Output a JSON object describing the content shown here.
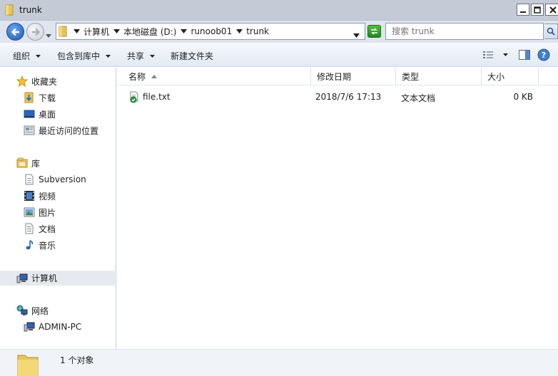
{
  "window": {
    "title": "trunk",
    "buttons": {
      "minimize": "minimize-icon",
      "maximize": "maximize-icon",
      "close": "close-icon"
    }
  },
  "address": {
    "breadcrumbs": [
      "计算机",
      "本地磁盘 (D:)",
      "runoob01",
      "trunk"
    ],
    "search_placeholder": "搜索 trunk"
  },
  "toolbar": {
    "organize": "组织",
    "include_in_library": "包含到库中",
    "share": "共享",
    "new_folder": "新建文件夹"
  },
  "nav": {
    "favorites": {
      "label": "收藏夹",
      "items": [
        {
          "label": "下载",
          "icon": "downloads-icon"
        },
        {
          "label": "桌面",
          "icon": "desktop-icon"
        },
        {
          "label": "最近访问的位置",
          "icon": "recent-places-icon"
        }
      ]
    },
    "libraries": {
      "label": "库",
      "items": [
        {
          "label": "Subversion",
          "icon": "library-doc-icon"
        },
        {
          "label": "视频",
          "icon": "video-icon"
        },
        {
          "label": "图片",
          "icon": "pictures-icon"
        },
        {
          "label": "文档",
          "icon": "documents-icon"
        },
        {
          "label": "音乐",
          "icon": "music-icon"
        }
      ]
    },
    "computer": {
      "label": "计算机"
    },
    "network": {
      "label": "网络",
      "items": [
        {
          "label": "ADMIN-PC",
          "icon": "pc-icon"
        }
      ]
    }
  },
  "columns": {
    "name": "名称",
    "date": "修改日期",
    "type": "类型",
    "size": "大小"
  },
  "files": [
    {
      "name": "file.txt",
      "date": "2018/7/6 17:13",
      "type": "文本文档",
      "size": "0 KB",
      "icon": "svn-text-file-icon"
    }
  ],
  "status": {
    "count": "1 个对象"
  },
  "colors": {
    "titlebar": "#c4cbd6",
    "address_bg": "#dfe5ee",
    "back_button": "#1d58b8",
    "refresh_button": "#1f8a1a",
    "folder": "#e8c45a",
    "selected_nav": "#e6eaef"
  }
}
